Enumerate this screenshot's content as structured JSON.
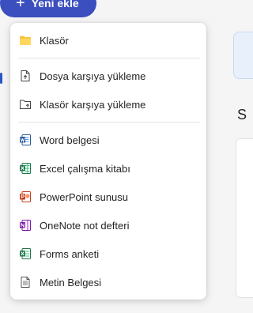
{
  "toolbar": {
    "new_label": "Yeni ekle"
  },
  "menu": {
    "items": [
      {
        "label": "Klasör",
        "icon": "folder-icon"
      },
      {
        "label": "Dosya karşıya yükleme",
        "icon": "file-upload-icon"
      },
      {
        "label": "Klasör karşıya yükleme",
        "icon": "folder-upload-icon"
      },
      {
        "label": "Word belgesi",
        "icon": "word-icon"
      },
      {
        "label": "Excel çalışma kitabı",
        "icon": "excel-icon"
      },
      {
        "label": "PowerPoint sunusu",
        "icon": "powerpoint-icon"
      },
      {
        "label": "OneNote not defteri",
        "icon": "onenote-icon"
      },
      {
        "label": "Forms anketi",
        "icon": "forms-icon"
      },
      {
        "label": "Metin Belgesi",
        "icon": "text-document-icon"
      }
    ]
  },
  "background": {
    "section_initial": "S"
  },
  "colors": {
    "accent": "#3b4fbf",
    "folder": "#f6c544",
    "word": "#2b579a",
    "excel": "#217346",
    "powerpoint": "#c43e1c",
    "onenote": "#7719aa"
  }
}
